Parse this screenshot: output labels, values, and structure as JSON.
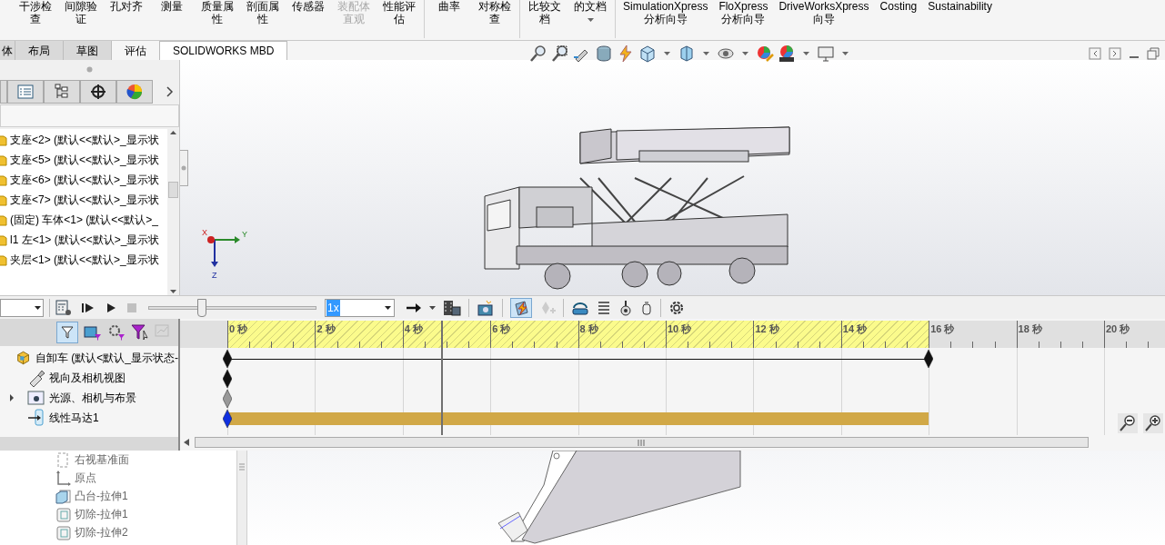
{
  "ribbon": {
    "buttons": [
      {
        "label": "干涉检查",
        "kind": "cjk",
        "disabled": false,
        "separator_after": false
      },
      {
        "label": "间隙验证",
        "kind": "cjk",
        "disabled": false,
        "separator_after": false
      },
      {
        "label": "孔对齐",
        "kind": "cjk",
        "disabled": false,
        "separator_after": false
      },
      {
        "label": "测量",
        "kind": "cjk",
        "disabled": false,
        "separator_after": false
      },
      {
        "label": "质量属性",
        "kind": "cjk",
        "disabled": false,
        "separator_after": false
      },
      {
        "label": "剖面属性",
        "kind": "cjk",
        "disabled": false,
        "separator_after": false
      },
      {
        "label": "传感器",
        "kind": "cjk",
        "disabled": false,
        "separator_after": false
      },
      {
        "label": "装配体直观",
        "kind": "cjk",
        "disabled": true,
        "separator_after": false
      },
      {
        "label": "性能评估",
        "kind": "cjk",
        "disabled": false,
        "separator_after": true
      },
      {
        "label": "曲率",
        "kind": "cjk",
        "disabled": false,
        "separator_after": false
      },
      {
        "label": "对称检查",
        "kind": "cjk",
        "disabled": false,
        "separator_after": true
      },
      {
        "label": "比较文档",
        "kind": "cjk",
        "disabled": false,
        "separator_after": false
      },
      {
        "label": "的文档",
        "kind": "cjk",
        "disabled": false,
        "separator_after": true,
        "dropdown": true
      },
      {
        "label": "SimulationXpress 分析向导",
        "kind": "latin",
        "disabled": false,
        "separator_after": false
      },
      {
        "label": "FloXpress 分析向导",
        "kind": "latin",
        "disabled": false,
        "separator_after": false
      },
      {
        "label": "DriveWorksXpress 向导",
        "kind": "latin",
        "disabled": false,
        "separator_after": false
      },
      {
        "label": "Costing",
        "kind": "latin",
        "disabled": false,
        "separator_after": false
      },
      {
        "label": "Sustainability",
        "kind": "latin",
        "disabled": false,
        "separator_after": false
      }
    ]
  },
  "tabs": [
    {
      "label": "体",
      "selected": false,
      "highlighted": false
    },
    {
      "label": "布局",
      "selected": false,
      "highlighted": false
    },
    {
      "label": "草图",
      "selected": false,
      "highlighted": false
    },
    {
      "label": "评估",
      "selected": true,
      "highlighted": false
    },
    {
      "label": "SOLIDWORKS MBD",
      "selected": false,
      "highlighted": true
    }
  ],
  "feature_manager": {
    "items": [
      "支座<2> (默认<<默认>_显示状",
      "支座<5> (默认<<默认>_显示状",
      "支座<6> (默认<<默认>_显示状",
      "支座<7> (默认<<默认>_显示状",
      "(固定) 车体<1> (默认<<默认>_",
      "l1 左<1> (默认<<默认>_显示状",
      "夹层<1> (默认<<默认>_显示状"
    ]
  },
  "viewport": {
    "triad": {
      "x": "X",
      "y": "Y",
      "z": "Z"
    }
  },
  "animation_toolbar": {
    "slider": {
      "level": 0.32
    },
    "speed": "1x"
  },
  "timeline": {
    "ticks": [
      "0 秒",
      "2 秒",
      "4 秒",
      "6 秒",
      "8 秒",
      "10 秒",
      "12 秒",
      "14 秒",
      "16 秒",
      "18 秒",
      "20 秒"
    ],
    "playhead": {
      "level": 0.228
    },
    "rows": [
      {
        "label": "自卸车  (默认<默认_显示状态-",
        "kind": "assembly"
      },
      {
        "label": "视向及相机视图",
        "kind": "view"
      },
      {
        "label": "光源、相机与布景",
        "kind": "lights",
        "expanded": false
      },
      {
        "label": "线性马达1",
        "kind": "motor"
      }
    ]
  },
  "part_tree": {
    "items": [
      "右视基准面",
      "原点",
      "凸台-拉伸1",
      "切除-拉伸1",
      "切除-拉伸2"
    ]
  }
}
